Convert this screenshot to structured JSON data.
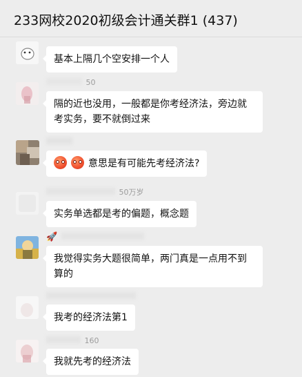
{
  "header": {
    "title": "233网校2020初级会计通关群1 (437)"
  },
  "messages": [
    {
      "sender": "",
      "text": "基本上隔几个空安排一个人"
    },
    {
      "sender": "50",
      "text": "隔的近也没用，一般都是你考经济法，旁边就考实务，要不就倒过来"
    },
    {
      "sender": "",
      "text": "意思是有可能先考经济法?",
      "emojis": [
        "angry-face-icon",
        "angry-face-icon"
      ]
    },
    {
      "sender": "50万岁",
      "text": "实务单选都是考的偏题，概念题"
    },
    {
      "sender": "",
      "text": "我觉得实务大题很简单，两门真是一点用不到算的",
      "prefix_icon": "rocket-icon"
    },
    {
      "sender": "",
      "text": "我考的经济法第1"
    },
    {
      "sender": "160",
      "text": "我就先考的经济法"
    }
  ],
  "colors": {
    "background": "#ededed",
    "bubble": "#ffffff",
    "sender_text": "#9c9c9c"
  }
}
